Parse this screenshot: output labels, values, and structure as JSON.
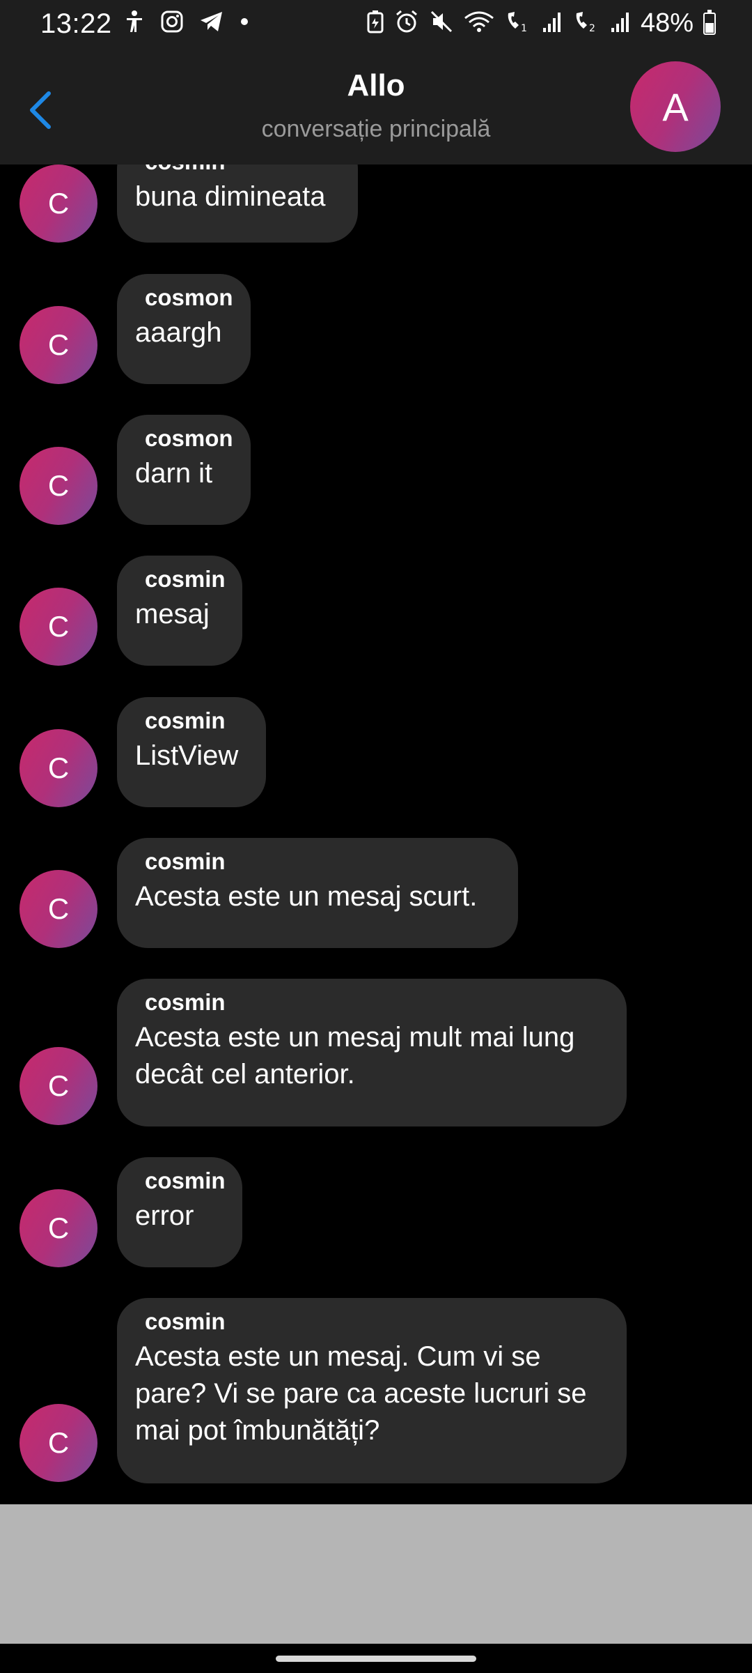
{
  "status_bar": {
    "time": "13:22",
    "battery_percent": "48%",
    "battery_level": 0.48,
    "left_icons": [
      "accessibility-icon",
      "instagram-icon",
      "telegram-icon",
      "dot-icon"
    ],
    "right_icons": [
      "battery-saver-icon",
      "alarm-icon",
      "mute-icon",
      "wifi-icon",
      "volte-1-icon",
      "signal-1-icon",
      "volte-2-icon",
      "signal-2-icon"
    ]
  },
  "header": {
    "title": "Allo",
    "subtitle": "conversație principală",
    "avatar_letter": "A",
    "back_icon": "chevron-left-icon",
    "accent_color": "#1e88e5"
  },
  "messages": [
    {
      "avatar": "C",
      "sender": "cosmin",
      "text": "buna dimineata"
    },
    {
      "avatar": "C",
      "sender": "cosmon",
      "text": "aaargh"
    },
    {
      "avatar": "C",
      "sender": "cosmon",
      "text": "darn it"
    },
    {
      "avatar": "C",
      "sender": "cosmin",
      "text": "mesaj"
    },
    {
      "avatar": "C",
      "sender": "cosmin",
      "text": "ListView"
    },
    {
      "avatar": "C",
      "sender": "cosmin",
      "text": "Acesta este un mesaj scurt."
    },
    {
      "avatar": "C",
      "sender": "cosmin",
      "text": "Acesta este un mesaj mult mai lung decât cel anterior."
    },
    {
      "avatar": "C",
      "sender": "cosmin",
      "text": "error"
    },
    {
      "avatar": "C",
      "sender": "cosmin",
      "text": "Acesta este un mesaj. Cum vi se pare? Vi se pare ca aceste lucruri se mai pot îmbunătăți?"
    }
  ]
}
